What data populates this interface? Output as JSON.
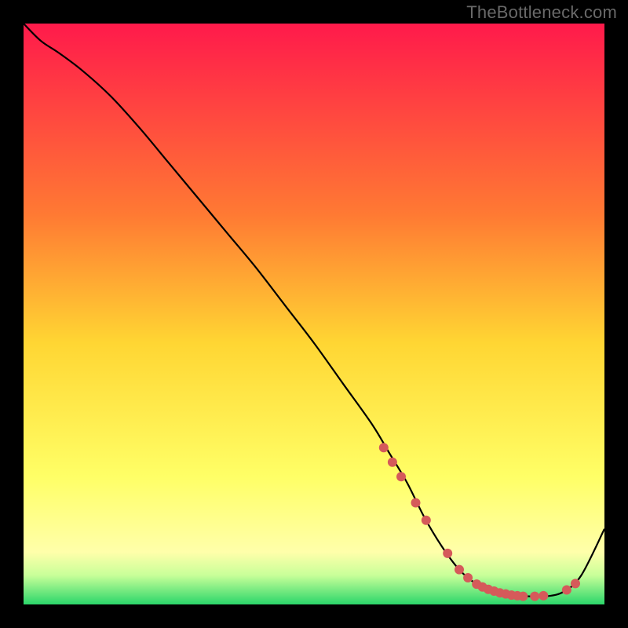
{
  "watermark": "TheBottleneck.com",
  "chart_data": {
    "type": "line",
    "title": "",
    "xlabel": "",
    "ylabel": "",
    "xlim": [
      0,
      100
    ],
    "ylim": [
      0,
      100
    ],
    "gradient_stops": [
      {
        "offset": 0,
        "color": "#ff1a4b"
      },
      {
        "offset": 33,
        "color": "#ff7a33"
      },
      {
        "offset": 55,
        "color": "#ffd633"
      },
      {
        "offset": 78,
        "color": "#ffff66"
      },
      {
        "offset": 91,
        "color": "#ffffaa"
      },
      {
        "offset": 95,
        "color": "#c8ff99"
      },
      {
        "offset": 100,
        "color": "#2bd66a"
      }
    ],
    "series": [
      {
        "name": "bottleneck-curve",
        "stroke": "#000000",
        "x": [
          0,
          3,
          6,
          10,
          15,
          20,
          25,
          30,
          35,
          40,
          45,
          50,
          55,
          60,
          63,
          66,
          69,
          72,
          75,
          78,
          81,
          84,
          87,
          90,
          93,
          96,
          100
        ],
        "y": [
          100,
          97,
          95,
          92,
          87.5,
          82,
          76,
          70,
          64,
          58,
          51.5,
          45,
          38,
          31,
          26,
          21,
          15,
          10,
          6,
          3.5,
          2.2,
          1.6,
          1.4,
          1.4,
          2.2,
          5,
          13
        ]
      }
    ],
    "highlight_dots": {
      "color": "#d55a5a",
      "radius": 6,
      "points": [
        {
          "x": 62,
          "y": 27
        },
        {
          "x": 63.5,
          "y": 24.5
        },
        {
          "x": 65,
          "y": 22
        },
        {
          "x": 67.5,
          "y": 17.5
        },
        {
          "x": 69.3,
          "y": 14.5
        },
        {
          "x": 73,
          "y": 8.8
        },
        {
          "x": 75,
          "y": 6.0
        },
        {
          "x": 76.5,
          "y": 4.6
        },
        {
          "x": 78,
          "y": 3.5
        },
        {
          "x": 79,
          "y": 3.0
        },
        {
          "x": 80,
          "y": 2.6
        },
        {
          "x": 81,
          "y": 2.3
        },
        {
          "x": 82,
          "y": 2.0
        },
        {
          "x": 83,
          "y": 1.8
        },
        {
          "x": 84,
          "y": 1.6
        },
        {
          "x": 85,
          "y": 1.5
        },
        {
          "x": 86,
          "y": 1.4
        },
        {
          "x": 88,
          "y": 1.4
        },
        {
          "x": 89.5,
          "y": 1.5
        },
        {
          "x": 93.5,
          "y": 2.5
        },
        {
          "x": 95,
          "y": 3.6
        }
      ]
    }
  }
}
